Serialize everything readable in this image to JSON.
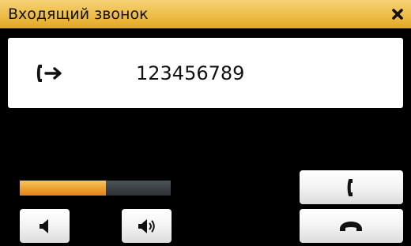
{
  "window": {
    "title": "Входящий звонок"
  },
  "call": {
    "direction_icon": "incoming-call-icon",
    "number": "123456789"
  },
  "volume": {
    "level": 0.57
  },
  "buttons": {
    "volume_down_icon": "speaker-low-icon",
    "volume_up_icon": "speaker-high-icon",
    "answer_icon": "phone-handset-icon",
    "hangup_icon": "hang-up-icon",
    "close_icon": "close-icon"
  },
  "colors": {
    "titlebar": "#edbd48",
    "volume_fill": "#ec9f2e",
    "volume_track": "#3a4045",
    "background": "#000000"
  }
}
